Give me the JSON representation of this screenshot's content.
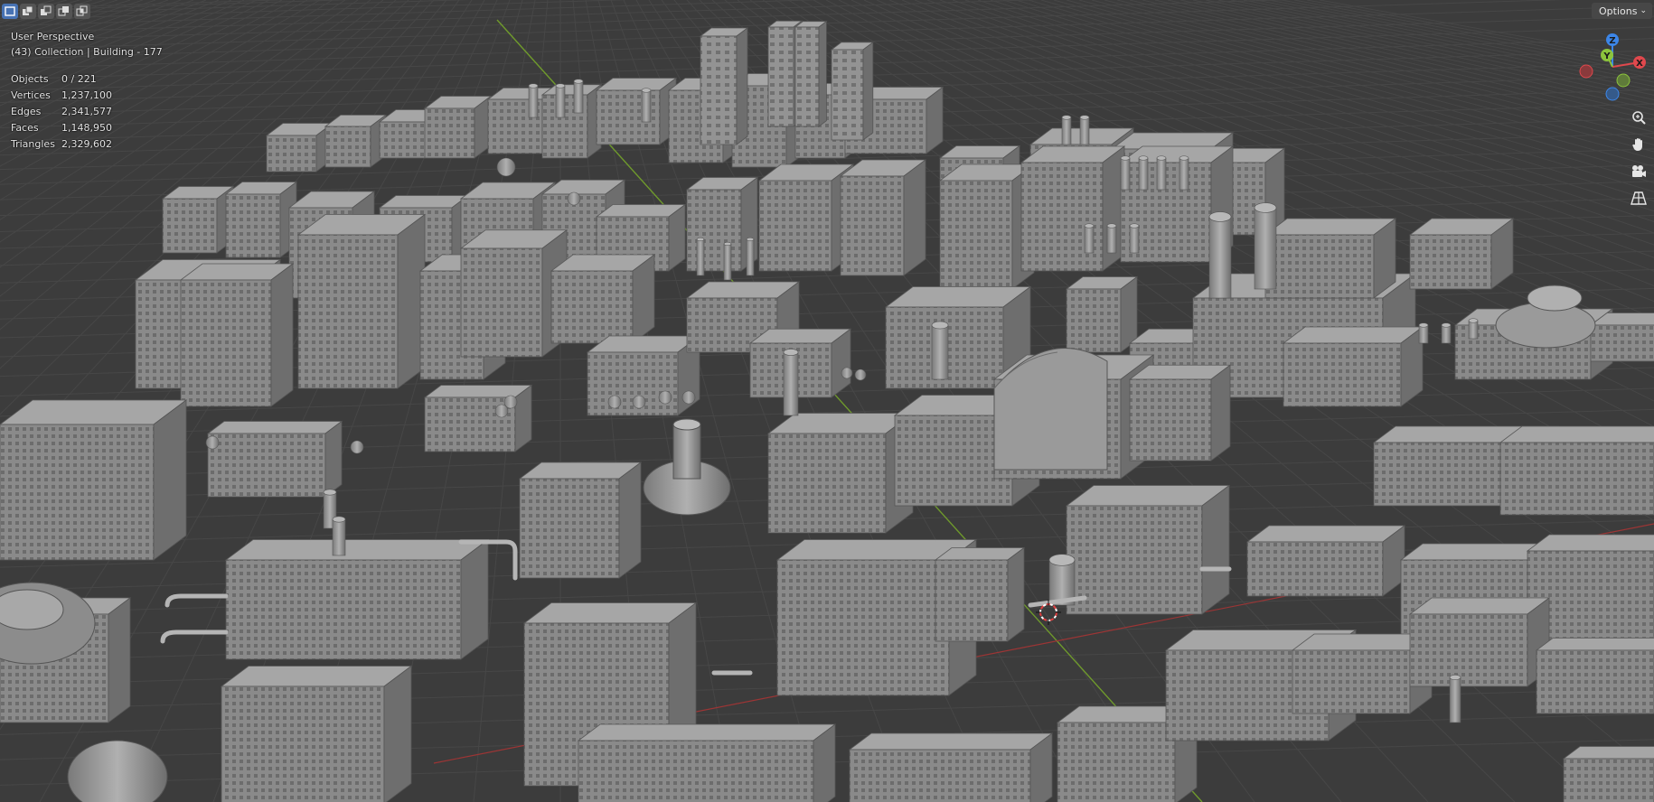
{
  "viewport": {
    "perspective_label": "User Perspective",
    "collection_label": "(43) Collection | Building - 177",
    "stats": [
      {
        "label": "Objects",
        "value": "0 / 221"
      },
      {
        "label": "Vertices",
        "value": "1,237,100"
      },
      {
        "label": "Edges",
        "value": "2,341,577"
      },
      {
        "label": "Faces",
        "value": "1,148,950"
      },
      {
        "label": "Triangles",
        "value": "2,329,602"
      }
    ]
  },
  "header": {
    "options_label": "Options",
    "select_modes": [
      "select-new",
      "select-extend",
      "select-subtract",
      "select-difference",
      "select-intersect"
    ],
    "active_select_mode": "select-new"
  },
  "gizmo": {
    "axes": {
      "x": "X",
      "y": "Y",
      "z": "Z"
    },
    "colors": {
      "x": "#e0484d",
      "y": "#8cc43c",
      "z": "#3c86e8",
      "neg_x": "#8a3a3c",
      "neg_y": "#5f7b3a",
      "neg_z": "#355a8a"
    }
  },
  "nav_icons": [
    "zoom-icon",
    "hand-pan-icon",
    "camera-icon",
    "grid-perspective-icon"
  ],
  "scene": {
    "background": "#3c3c3c",
    "grid_color": "#474747",
    "axis_x_color": "#9c3535",
    "axis_y_color": "#6f9a2c",
    "building_fill": "#8f8f8f",
    "building_top": "#a6a6a6",
    "building_side": "#6e6e6e"
  }
}
